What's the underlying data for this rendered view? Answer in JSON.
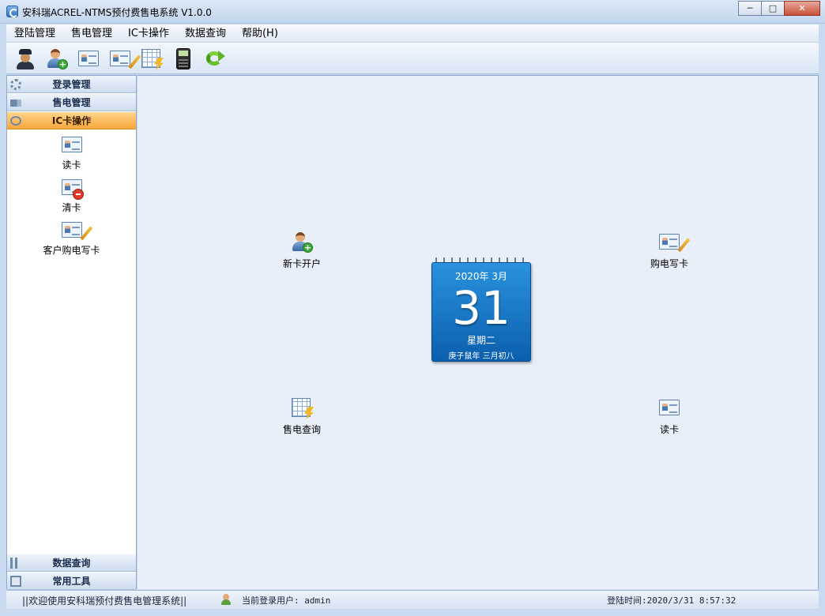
{
  "window": {
    "title": "安科瑞ACREL-NTMS预付费售电系统 V1.0.0",
    "min_label": "─",
    "max_label": "□",
    "close_label": "✕"
  },
  "menu": {
    "items": [
      "登陆管理",
      "售电管理",
      "IC卡操作",
      "数据查询",
      "帮助(H)"
    ]
  },
  "toolbar": {
    "icons": [
      "police-icon",
      "add-user-icon",
      "read-card-icon",
      "write-card-icon",
      "sales-table-icon",
      "calculator-icon",
      "refresh-icon"
    ]
  },
  "sidebar": {
    "sections": [
      {
        "label": "登录管理",
        "icon": "gear-icon"
      },
      {
        "label": "售电管理",
        "icon": "truck-icon"
      },
      {
        "label": "IC卡操作",
        "icon": "anchor-icon",
        "active": true
      },
      {
        "label": "数据查询",
        "icon": "tools-icon"
      },
      {
        "label": "常用工具",
        "icon": "document-icon"
      }
    ],
    "items": [
      {
        "label": "读卡",
        "icon": "read-card-icon"
      },
      {
        "label": "清卡",
        "icon": "clear-card-icon"
      },
      {
        "label": "客户购电写卡",
        "icon": "write-card-icon"
      }
    ]
  },
  "main": {
    "shortcuts": [
      {
        "label": "新卡开户",
        "icon": "new-account-icon"
      },
      {
        "label": "购电写卡",
        "icon": "purchase-write-card-icon"
      },
      {
        "label": "售电查询",
        "icon": "sales-query-icon"
      },
      {
        "label": "读卡",
        "icon": "read-card-icon"
      }
    ],
    "calendar": {
      "year_month": "2020年  3月",
      "day": "31",
      "weekday": "星期二",
      "lunar": "庚子鼠年  三月初八"
    }
  },
  "status": {
    "welcome": "||欢迎使用安科瑞预付费售电管理系统||",
    "current_user": "当前登录用户: admin",
    "login_time": "登陆时间:2020/3/31 8:57:32"
  },
  "colors": {
    "accent_active": "#f6a739",
    "calendar_blue": "#0b5fae"
  }
}
